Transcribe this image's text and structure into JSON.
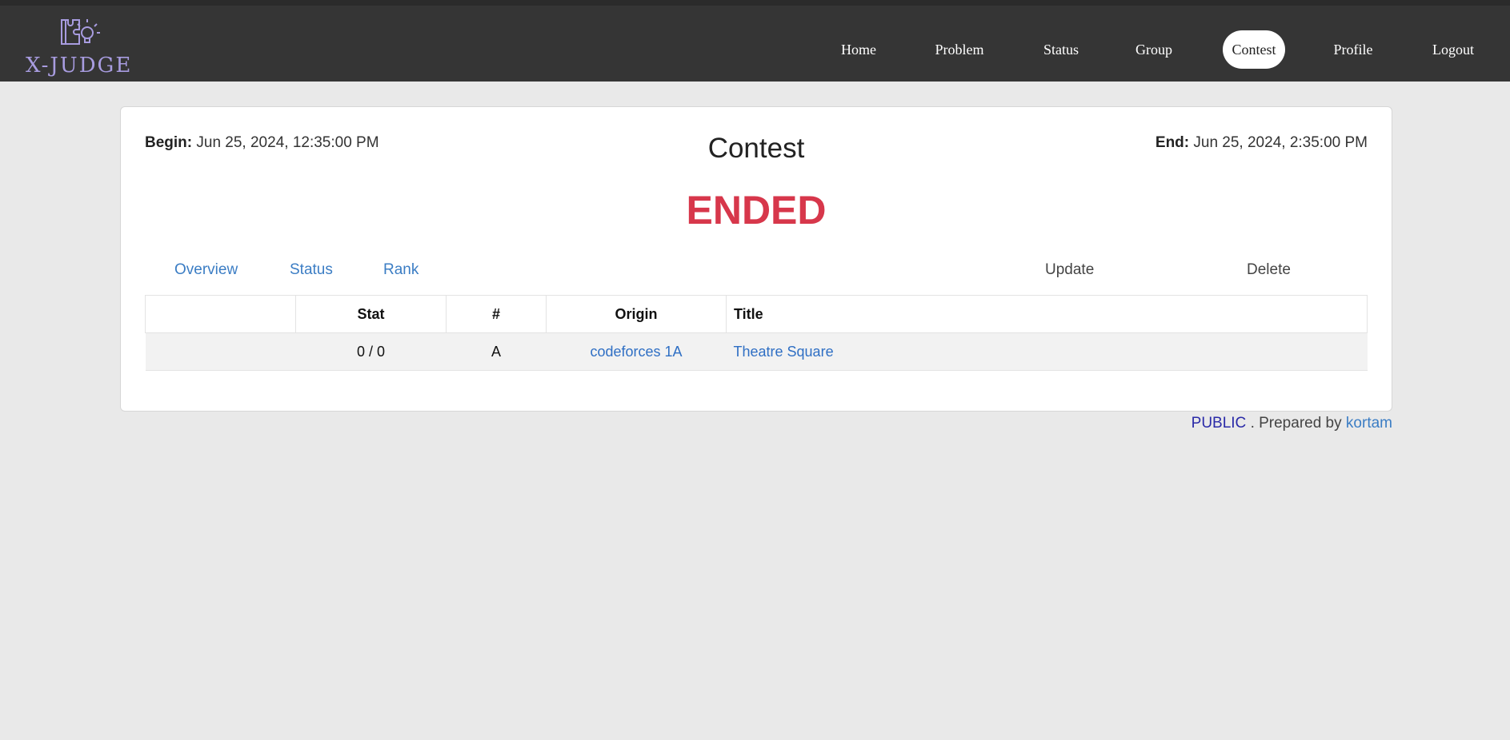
{
  "brand": {
    "name": "X-JUDGE",
    "color": "#a89ce0"
  },
  "nav": {
    "items": [
      {
        "label": "Home",
        "active": false
      },
      {
        "label": "Problem",
        "active": false
      },
      {
        "label": "Status",
        "active": false
      },
      {
        "label": "Group",
        "active": false
      },
      {
        "label": "Contest",
        "active": true
      },
      {
        "label": "Profile",
        "active": false
      },
      {
        "label": "Logout",
        "active": false
      }
    ]
  },
  "contest": {
    "begin_label": "Begin:",
    "begin_value": "Jun 25, 2024, 12:35:00 PM",
    "end_label": "End:",
    "end_value": "Jun 25, 2024, 2:35:00 PM",
    "title": "Contest",
    "state": "ENDED",
    "state_color": "#d7374b"
  },
  "tabs": [
    {
      "label": "Overview"
    },
    {
      "label": "Status"
    },
    {
      "label": "Rank"
    }
  ],
  "actions": {
    "update": "Update",
    "delete": "Delete"
  },
  "problems": {
    "headers": [
      "",
      "Stat",
      "#",
      "Origin",
      "Title"
    ],
    "rows": [
      {
        "blank": "",
        "stat": "0 / 0",
        "index": "A",
        "origin": "codeforces 1A",
        "title": "Theatre Square"
      }
    ]
  },
  "footer": {
    "visibility": "PUBLIC",
    "prepared_by": ". Prepared by",
    "author": "kortam"
  }
}
